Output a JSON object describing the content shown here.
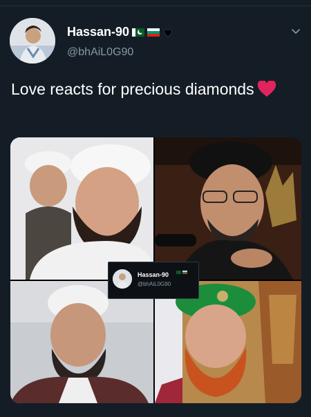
{
  "tweet": {
    "display_name": "Hassan-90",
    "handle": "@bhAiL0G90",
    "text": "Love reacts for precious diamonds",
    "icons": {
      "flag_1": "pakistan-flag",
      "flag_2": "bulgaria-flag",
      "badge": "black-heart",
      "reaction": "red-heart",
      "menu": "chevron-down"
    },
    "colors": {
      "background": "#141d26",
      "handle": "#8899a6",
      "heart": "#e0245e"
    }
  },
  "quoted_card": {
    "display_name": "Hassan-90",
    "handle": "@bhAiL0G90"
  }
}
